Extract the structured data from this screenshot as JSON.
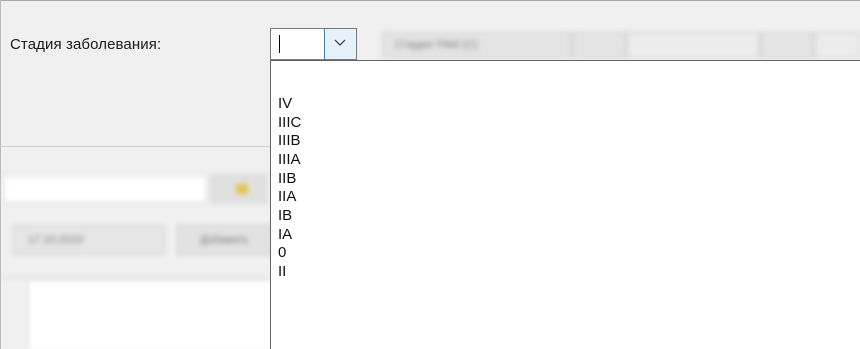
{
  "form": {
    "stage_label": "Стадия заболевания:"
  },
  "stage_select": {
    "current_value": "",
    "options": [
      "IV",
      "IIIC",
      "IIIB",
      "IIIA",
      "IIB",
      "IIA",
      "IB",
      "IA",
      "0",
      "II"
    ]
  },
  "blurred_toolbar": {
    "field_a": "Стадия TNM (С)"
  },
  "lower_panel": {
    "date_value": "17.10.2019",
    "add_button": "Добавить"
  }
}
